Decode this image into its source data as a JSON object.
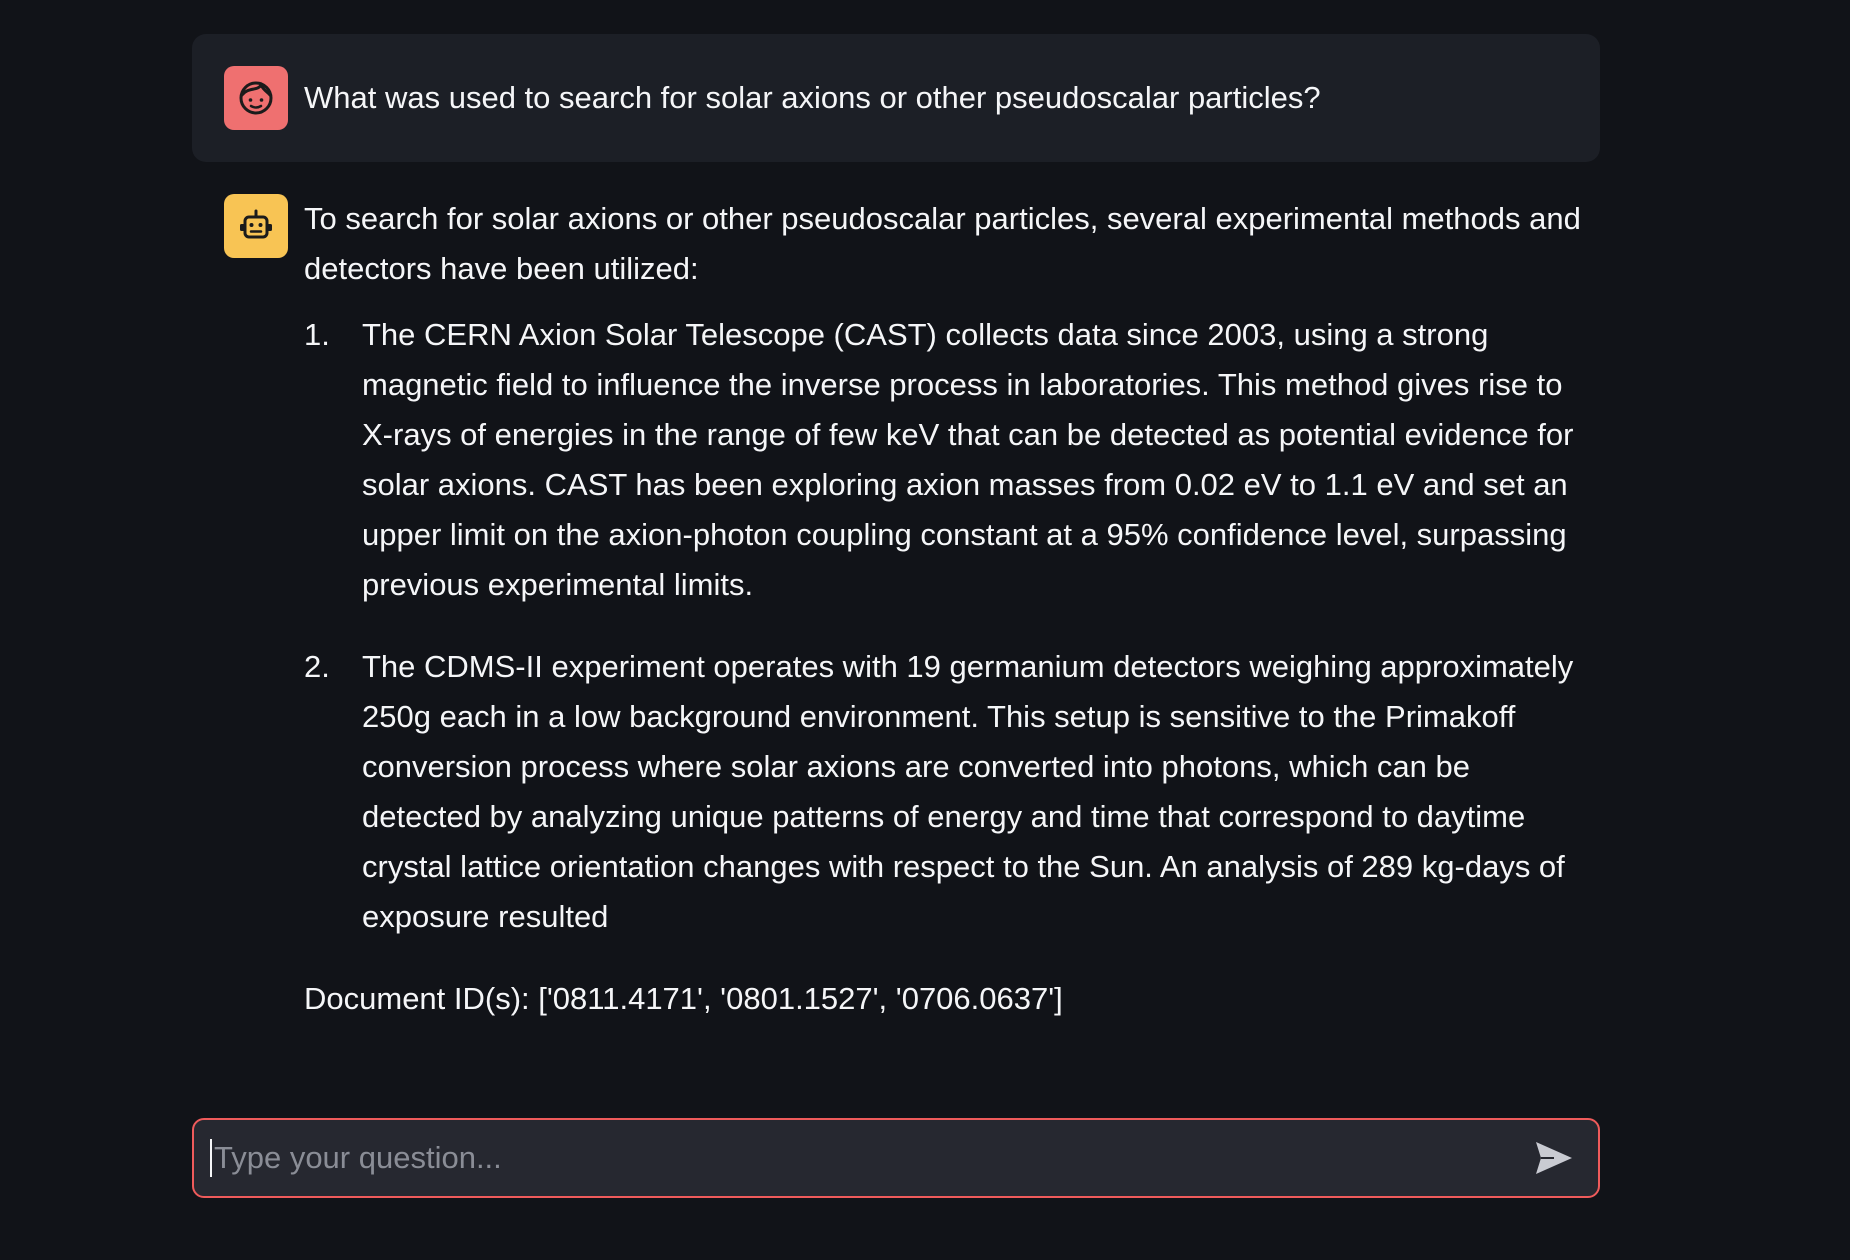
{
  "conversation": {
    "user_message": "What was used to search for solar axions or other pseudoscalar particles?",
    "bot_intro": "To search for solar axions or other pseudoscalar particles, several experimental methods and detectors have been utilized:",
    "items": [
      {
        "number": "1.",
        "text": "The CERN Axion Solar Telescope (CAST) collects data since 2003, using a strong magnetic field to influence the inverse process in laboratories. This method gives rise to X-rays of energies in the range of few keV that can be detected as potential evidence for solar axions. CAST has been exploring axion masses from 0.02 eV to 1.1 eV and set an upper limit on the axion-photon coupling constant at a 95% confidence level, surpassing previous experimental limits."
      },
      {
        "number": "2.",
        "text": "The CDMS-II experiment operates with 19 germanium detectors weighing approximately 250g each in a low background environment. This setup is sensitive to the Primakoff conversion process where solar axions are converted into photons, which can be detected by analyzing unique patterns of energy and time that correspond to daytime crystal lattice orientation changes with respect to the Sun. An analysis of 289 kg-days of exposure resulted"
      }
    ],
    "document_ids": "Document ID(s): ['0811.4171', '0801.1527', '0706.0637']"
  },
  "input": {
    "placeholder": "Type your question...",
    "value": ""
  },
  "icons": {
    "user_avatar": "face-icon",
    "bot_avatar": "robot-icon",
    "send": "send-icon"
  },
  "colors": {
    "background": "#111318",
    "user_bubble": "#1c1f26",
    "user_avatar": "#ef7070",
    "bot_avatar": "#f8c454",
    "input_border": "#ef5b5b"
  }
}
